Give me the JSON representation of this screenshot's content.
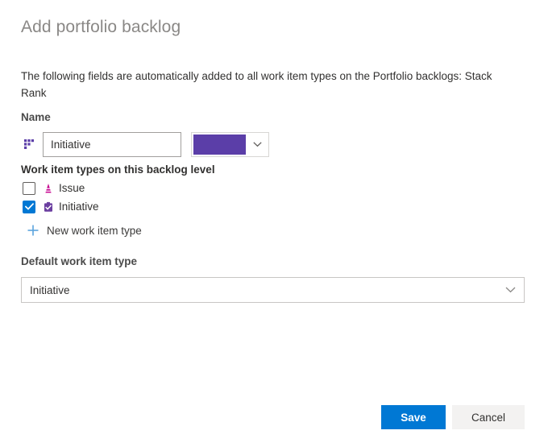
{
  "dialog": {
    "title": "Add portfolio backlog",
    "description": "The following fields are automatically added to all work item types on the Portfolio backlogs: Stack Rank"
  },
  "name_section": {
    "label": "Name",
    "drag_handle_icon": "drag-handle-icon",
    "input_value": "Initiative",
    "input_placeholder": "Name",
    "color_swatch": "#5B3EA8",
    "color_caret_icon": "chevron-down-icon"
  },
  "work_item_types": {
    "label": "Work item types on this backlog level",
    "items": [
      {
        "name": "Issue",
        "checked": false,
        "icon": "issue-cone-icon",
        "icon_color": "#CC293D"
      },
      {
        "name": "Initiative",
        "checked": true,
        "icon": "initiative-clipboard-icon",
        "icon_color": "#773B93"
      }
    ],
    "new_item": {
      "label": "New work item type",
      "icon": "plus-icon",
      "icon_color": "#5BA5DE"
    }
  },
  "default_section": {
    "label": "Default work item type",
    "selected": "Initiative",
    "caret_icon": "chevron-down-icon"
  },
  "footer": {
    "save_label": "Save",
    "cancel_label": "Cancel"
  },
  "colors": {
    "accent_blue": "#0078D4",
    "purple": "#5B3EA8",
    "magenta": "#C5008E",
    "light_blue": "#5BA5DE"
  }
}
